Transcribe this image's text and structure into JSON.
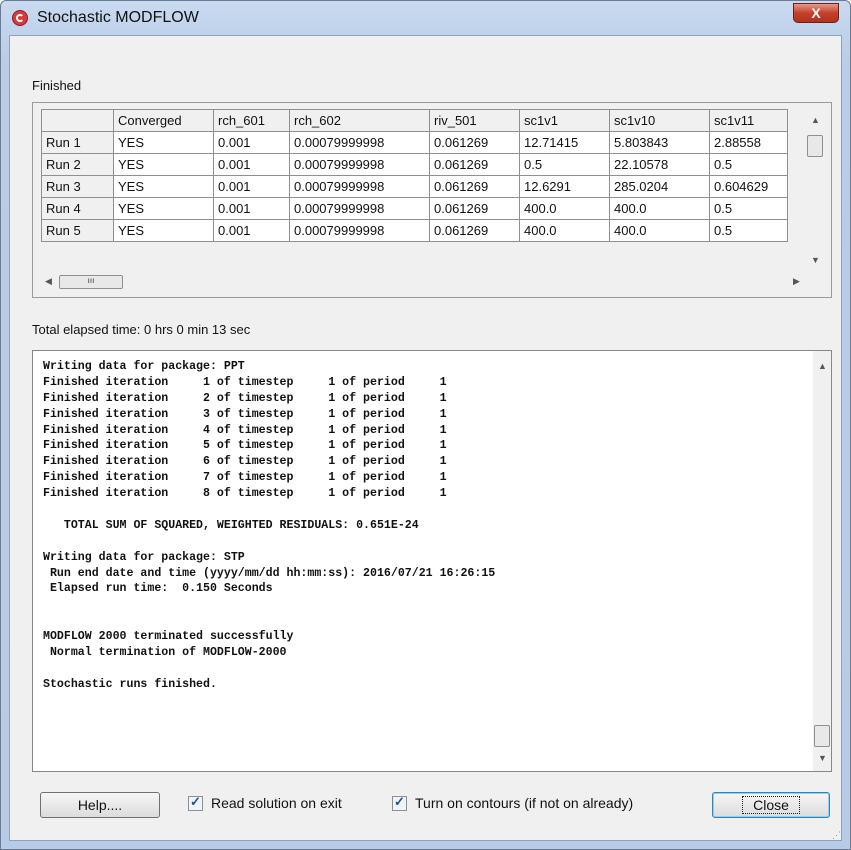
{
  "window": {
    "title": "Stochastic MODFLOW",
    "close_label": "X"
  },
  "status": {
    "label": "Finished"
  },
  "grid": {
    "columns": [
      "",
      "Converged",
      "rch_601",
      "rch_602",
      "riv_501",
      "sc1v1",
      "sc1v10",
      "sc1v11"
    ],
    "rows": [
      [
        "Run 1",
        "YES",
        "0.001",
        "0.00079999998",
        "0.061269",
        "12.71415",
        "5.803843",
        "2.88558"
      ],
      [
        "Run 2",
        "YES",
        "0.001",
        "0.00079999998",
        "0.061269",
        "0.5",
        "22.10578",
        "0.5"
      ],
      [
        "Run 3",
        "YES",
        "0.001",
        "0.00079999998",
        "0.061269",
        "12.6291",
        "285.0204",
        "0.604629"
      ],
      [
        "Run 4",
        "YES",
        "0.001",
        "0.00079999998",
        "0.061269",
        "400.0",
        "400.0",
        "0.5"
      ],
      [
        "Run 5",
        "YES",
        "0.001",
        "0.00079999998",
        "0.061269",
        "400.0",
        "400.0",
        "0.5"
      ]
    ]
  },
  "elapsed": {
    "text": "Total elapsed time: 0 hrs 0 min 13 sec"
  },
  "log": {
    "lines": [
      "Writing data for package: PPT",
      "Finished iteration     1 of timestep     1 of period     1",
      "Finished iteration     2 of timestep     1 of period     1",
      "Finished iteration     3 of timestep     1 of period     1",
      "Finished iteration     4 of timestep     1 of period     1",
      "Finished iteration     5 of timestep     1 of period     1",
      "Finished iteration     6 of timestep     1 of period     1",
      "Finished iteration     7 of timestep     1 of period     1",
      "Finished iteration     8 of timestep     1 of period     1",
      "",
      "   TOTAL SUM OF SQUARED, WEIGHTED RESIDUALS: 0.651E-24",
      "",
      "Writing data for package: STP",
      " Run end date and time (yyyy/mm/dd hh:mm:ss): 2016/07/21 16:26:15",
      " Elapsed run time:  0.150 Seconds",
      "",
      "",
      "MODFLOW 2000 terminated successfully",
      " Normal termination of MODFLOW-2000",
      "",
      "Stochastic runs finished."
    ]
  },
  "footer": {
    "help_label": "Help....",
    "read_solution_label": "Read solution on exit",
    "read_solution_checked": true,
    "contours_label": "Turn on contours (if not on already)",
    "contours_checked": true,
    "close_label": "Close"
  }
}
